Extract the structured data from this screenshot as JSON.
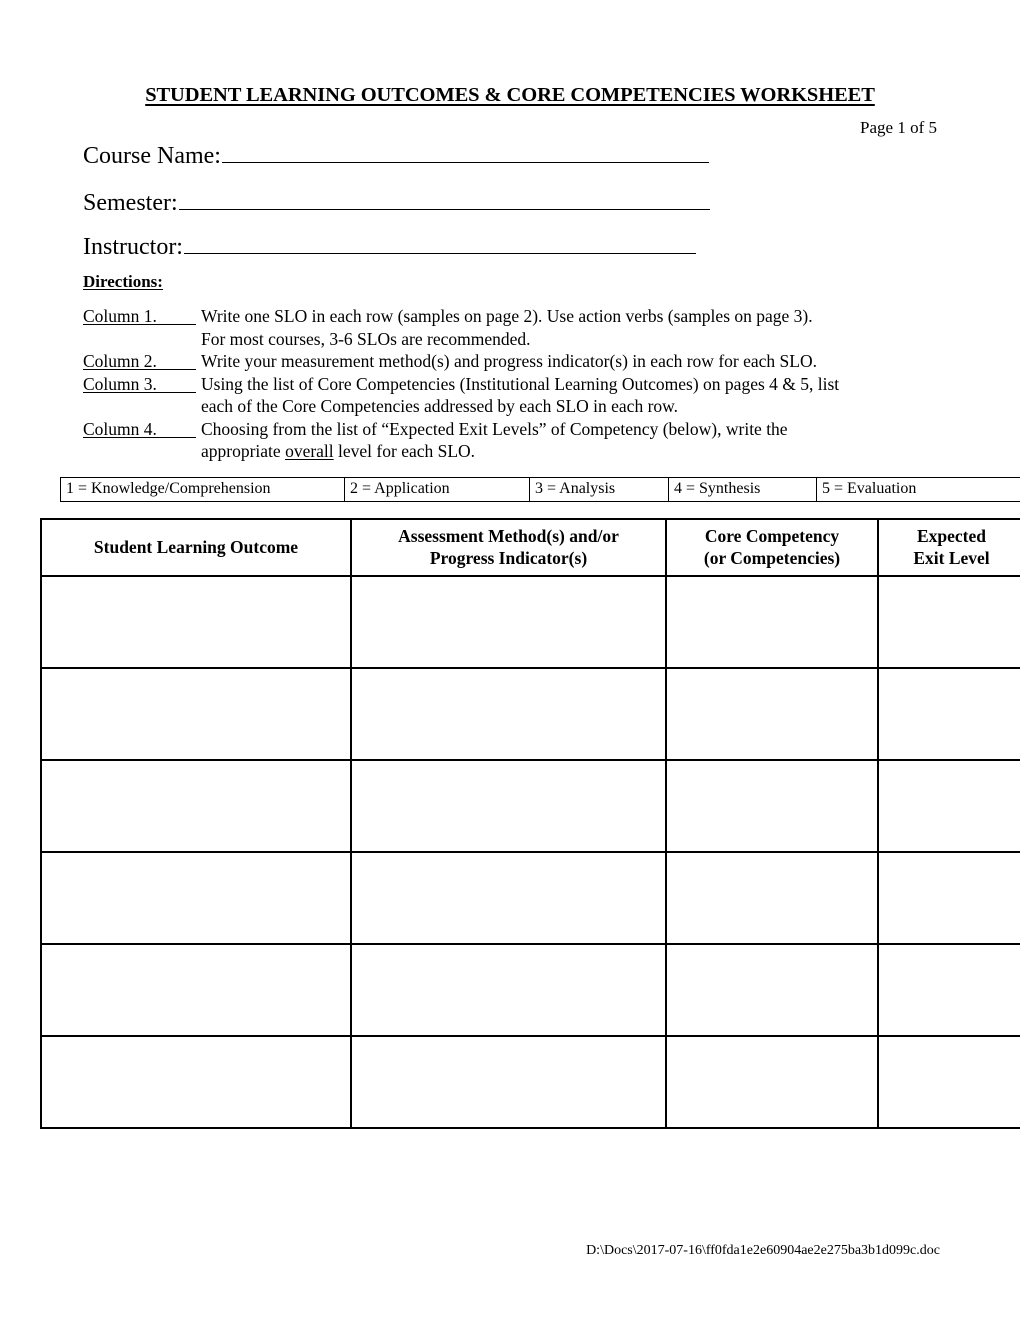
{
  "document": {
    "title": "STUDENT LEARNING OUTCOMES & CORE COMPETENCIES WORKSHEET",
    "page_indicator": "Page 1 of 5",
    "footer_path": "D:\\Docs\\2017-07-16\\ff0fda1e2e60904ae2e275ba3b1d099c.doc"
  },
  "form_fields": {
    "course_name_label": "Course Name:",
    "course_name_value": "",
    "semester_label": "Semester:",
    "semester_value": "",
    "instructor_label": "Instructor:",
    "instructor_value": ""
  },
  "directions": {
    "heading": "Directions:",
    "items": [
      {
        "tag": "Column 1.",
        "line1_pre": "Write one SLO in each row (samples on page 2).  Use action verbs (samples on page 3).",
        "line2_pre": "For most courses, 3-6 SLOs are recommended.",
        "emphasis": "",
        "line2_post": ""
      },
      {
        "tag": "Column 2.",
        "line1_pre": "Write your measurement method(s) and progress indicator(s) in each row for each SLO.",
        "line2_pre": "",
        "emphasis": "",
        "line2_post": ""
      },
      {
        "tag": "Column 3.",
        "line1_pre": "Using the list of Core Competencies (Institutional Learning Outcomes) on pages 4 & 5, list",
        "line2_pre": "each of the Core Competencies addressed by each SLO in each row.",
        "emphasis": "",
        "line2_post": ""
      },
      {
        "tag": "Column 4.",
        "line1_pre": "Choosing from the list of “Expected Exit Levels” of Competency (below), write the",
        "line2_pre": "appropriate ",
        "emphasis": "overall",
        "line2_post": " level for each SLO."
      }
    ]
  },
  "levels_legend": [
    "1 = Knowledge/Comprehension",
    "2 = Application",
    "3 = Analysis",
    "4 = Synthesis",
    "5 = Evaluation"
  ],
  "worksheet": {
    "headers": [
      "Student Learning Outcome",
      "Assessment Method(s) and/or Progress Indicator(s)",
      "Core Competency (or Competencies)",
      "Expected Exit Level"
    ],
    "header_lines": [
      [
        "Student Learning Outcome"
      ],
      [
        "Assessment Method(s) and/or",
        "Progress Indicator(s)"
      ],
      [
        "Core Competency",
        "(or Competencies)"
      ],
      [
        "Expected",
        "Exit Level"
      ]
    ],
    "row_count": 6,
    "rows": [
      {
        "slo": "",
        "assessment": "",
        "competency": "",
        "exit_level": ""
      },
      {
        "slo": "",
        "assessment": "",
        "competency": "",
        "exit_level": ""
      },
      {
        "slo": "",
        "assessment": "",
        "competency": "",
        "exit_level": ""
      },
      {
        "slo": "",
        "assessment": "",
        "competency": "",
        "exit_level": ""
      },
      {
        "slo": "",
        "assessment": "",
        "competency": "",
        "exit_level": ""
      },
      {
        "slo": "",
        "assessment": "",
        "competency": "",
        "exit_level": ""
      }
    ]
  },
  "colors": {
    "text": "#000000",
    "background": "#ffffff",
    "border": "#000000"
  }
}
